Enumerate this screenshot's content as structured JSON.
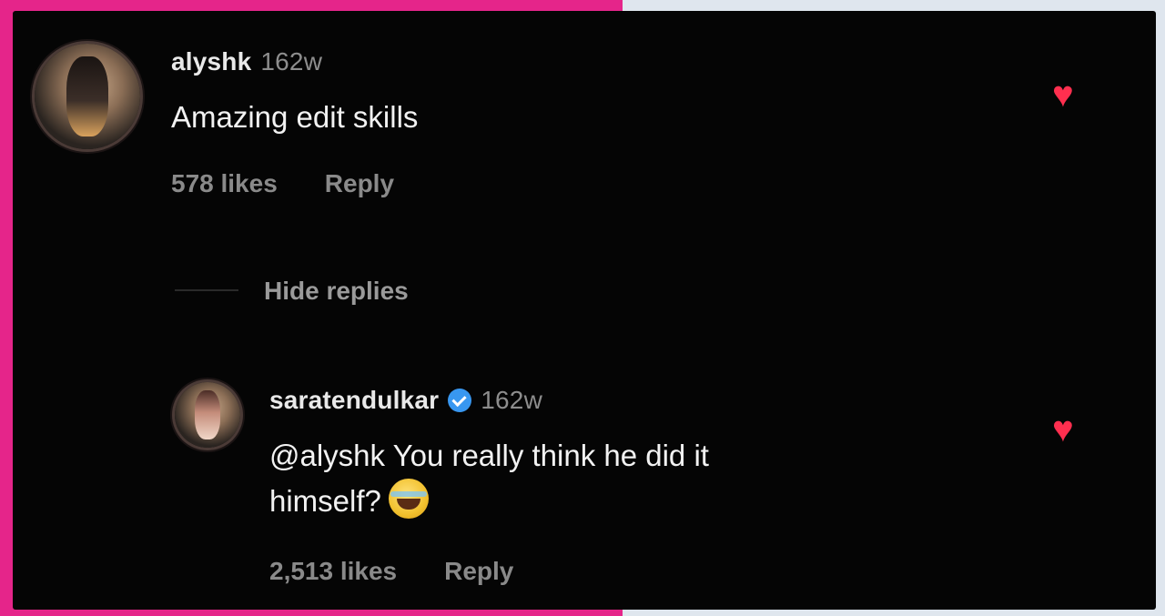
{
  "comments": [
    {
      "username": "alyshk",
      "time": "162w",
      "text": "Amazing edit skills",
      "likes": "578 likes",
      "reply_label": "Reply",
      "liked": true
    }
  ],
  "thread": {
    "toggle_label": "Hide replies"
  },
  "replies": [
    {
      "username": "saratendulkar",
      "verified": true,
      "time": "162w",
      "text_line1": "@alyshk You really think he did it",
      "text_line2": "himself?",
      "emoji": "crying-laughing-emoji",
      "likes": "2,513 likes",
      "reply_label": "Reply",
      "liked": true
    }
  ],
  "colors": {
    "background": "#050505",
    "heart": "#ff2f4f",
    "verified": "#3897f0",
    "frame_left": "#e5258a"
  }
}
